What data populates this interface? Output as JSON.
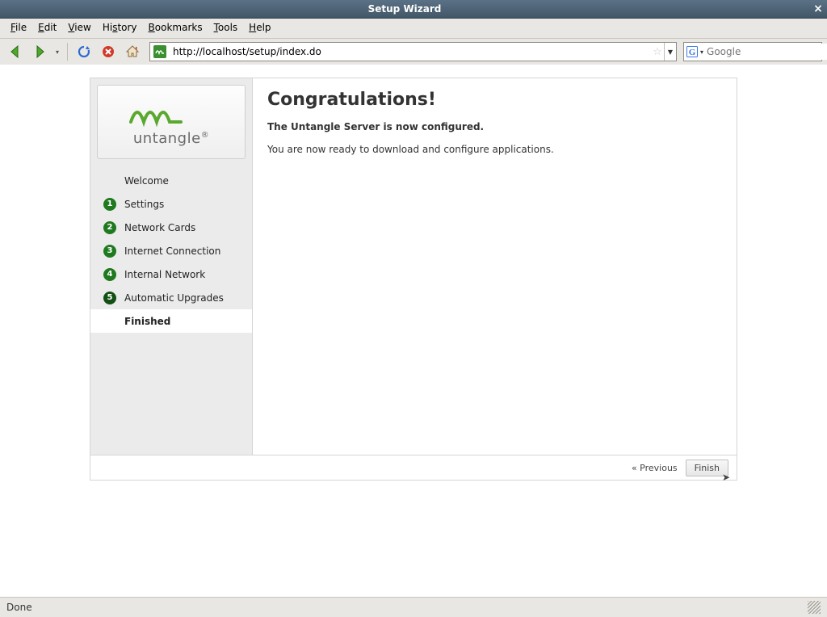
{
  "window": {
    "title": "Setup Wizard"
  },
  "menu": {
    "file": "File",
    "edit": "Edit",
    "view": "View",
    "history": "History",
    "bookmarks": "Bookmarks",
    "tools": "Tools",
    "help": "Help"
  },
  "url": {
    "value": "http://localhost/setup/index.do"
  },
  "search": {
    "placeholder": "Google"
  },
  "status": "Done",
  "brand": {
    "name": "untangle",
    "mark": "®"
  },
  "steps": [
    {
      "n": "",
      "label": "Welcome",
      "state": "done"
    },
    {
      "n": "1",
      "label": "Settings",
      "state": "done"
    },
    {
      "n": "2",
      "label": "Network Cards",
      "state": "done"
    },
    {
      "n": "3",
      "label": "Internet Connection",
      "state": "done"
    },
    {
      "n": "4",
      "label": "Internal Network",
      "state": "done"
    },
    {
      "n": "5",
      "label": "Automatic Upgrades",
      "state": "done"
    },
    {
      "n": "",
      "label": "Finished",
      "state": "current"
    }
  ],
  "page": {
    "heading": "Congratulations!",
    "lead": "The Untangle Server is now configured.",
    "body": "You are now ready to download and configure applications."
  },
  "nav": {
    "previous": "« Previous",
    "finish": "Finish"
  }
}
